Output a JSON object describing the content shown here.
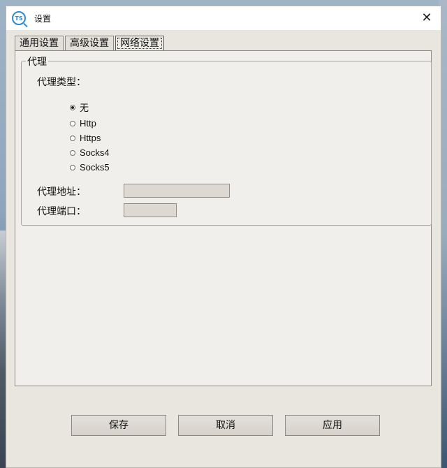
{
  "window": {
    "title": "设置",
    "app_icon_text": "TS",
    "close_glyph": "✕"
  },
  "tabs": [
    {
      "label": "通用设置",
      "active": false
    },
    {
      "label": "高级设置",
      "active": false
    },
    {
      "label": "网络设置",
      "active": true
    }
  ],
  "proxy_group": {
    "title": "代理",
    "type_label": "代理类型：",
    "options": [
      {
        "label": "无",
        "checked": true
      },
      {
        "label": "Http",
        "checked": false
      },
      {
        "label": "Https",
        "checked": false
      },
      {
        "label": "Socks4",
        "checked": false
      },
      {
        "label": "Socks5",
        "checked": false
      }
    ],
    "address_label": "代理地址：",
    "address_value": "",
    "port_label": "代理端口：",
    "port_value": ""
  },
  "buttons": {
    "save": "保存",
    "cancel": "取消",
    "apply": "应用"
  }
}
